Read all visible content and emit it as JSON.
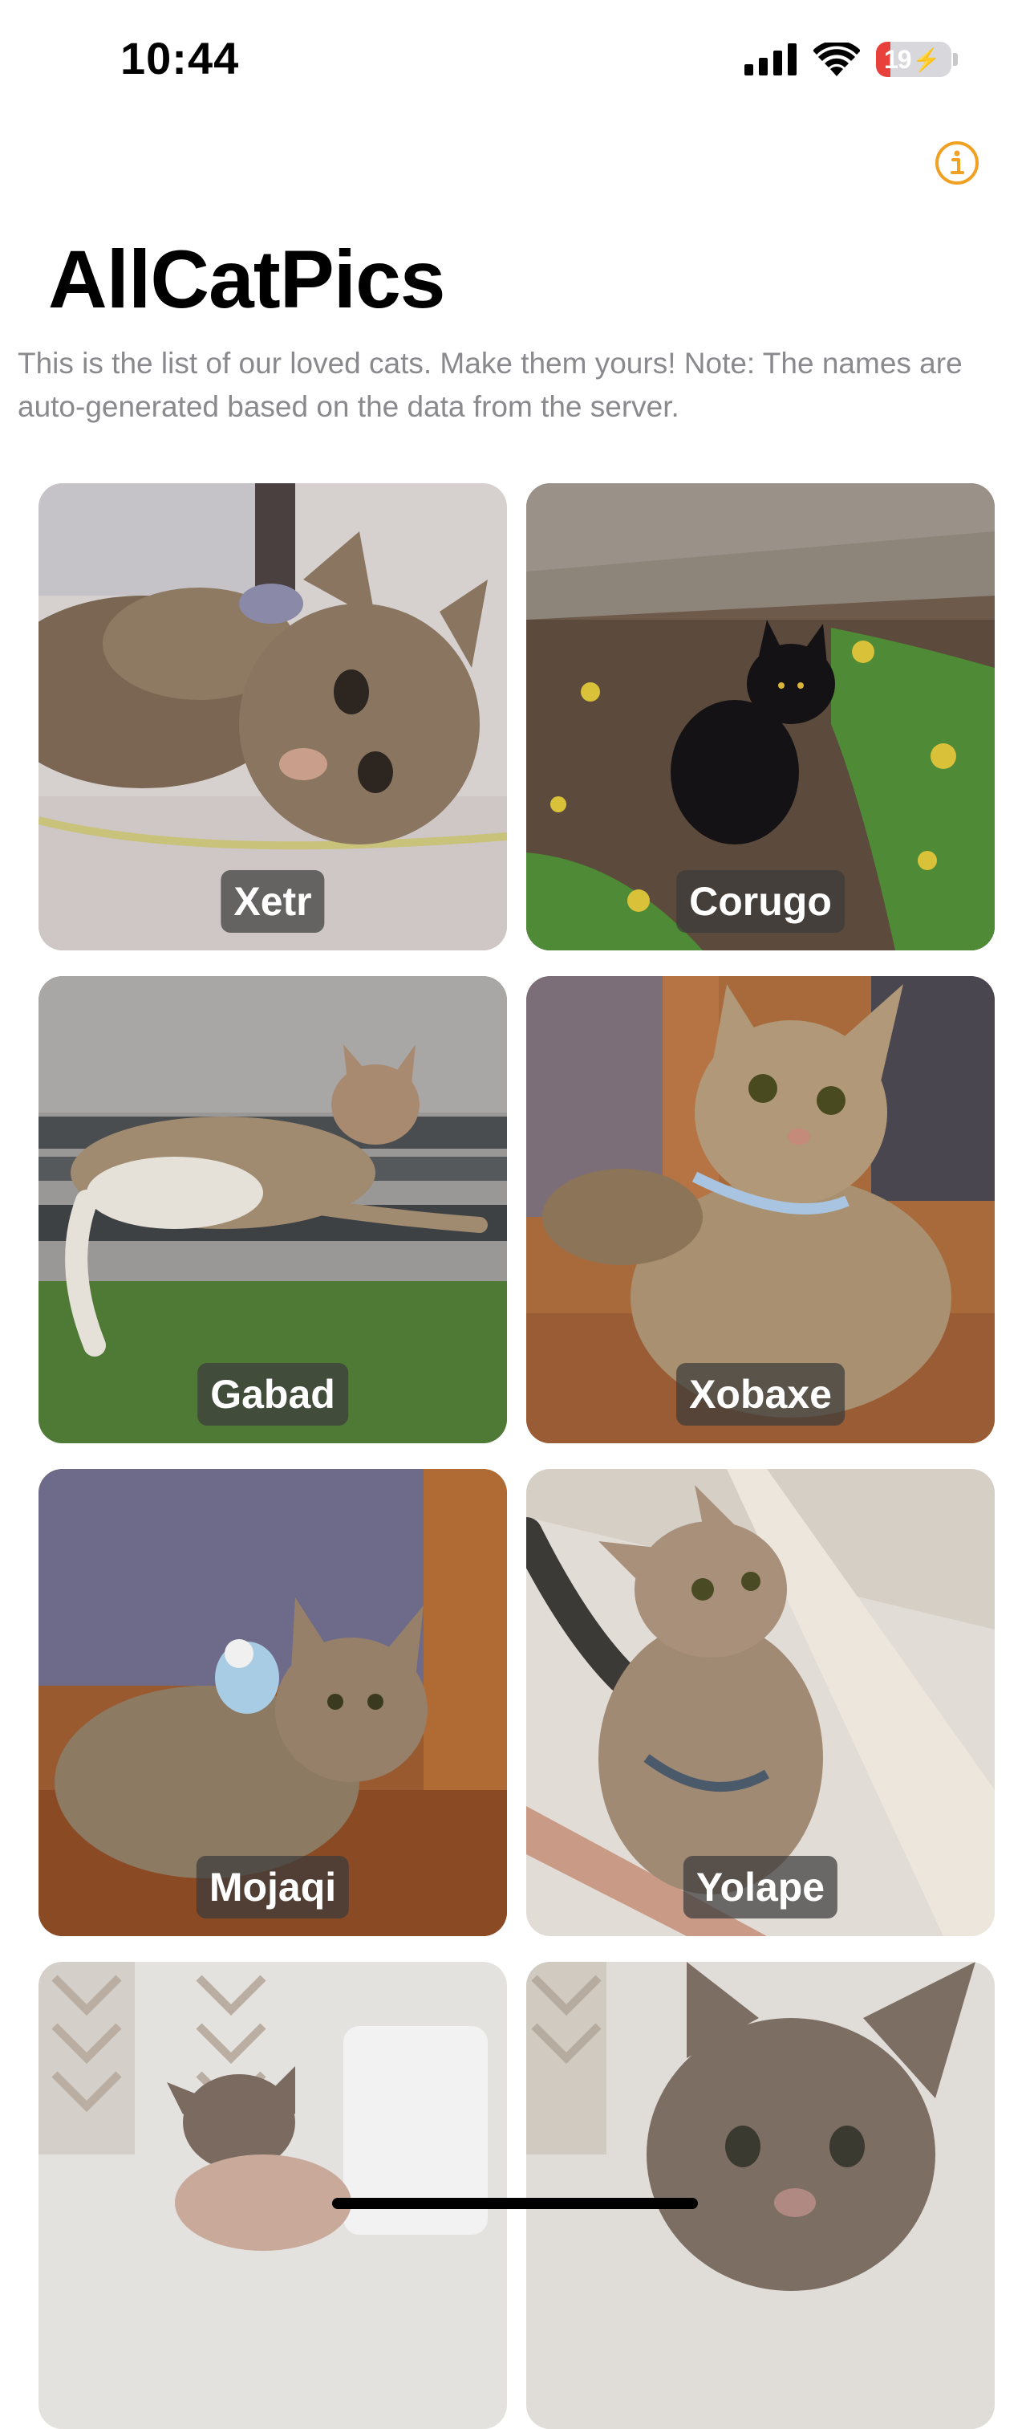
{
  "status_bar": {
    "time": "10:44",
    "battery_level": "19",
    "signal_icon": "cellular-signal-icon",
    "wifi_icon": "wifi-icon"
  },
  "header": {
    "info_icon": "info-icon",
    "accent_color": "#F0A023"
  },
  "page": {
    "title": "AllCatPics",
    "subtitle": "This is the list of our loved cats. Make them yours! Note: The names are auto-generated based on the data from the server."
  },
  "cats": [
    {
      "name": "Xetr"
    },
    {
      "name": "Corugo"
    },
    {
      "name": "Gabad"
    },
    {
      "name": "Xobaxe"
    },
    {
      "name": "Mojaqi"
    },
    {
      "name": "Yolape"
    },
    {
      "name": ""
    },
    {
      "name": ""
    }
  ]
}
